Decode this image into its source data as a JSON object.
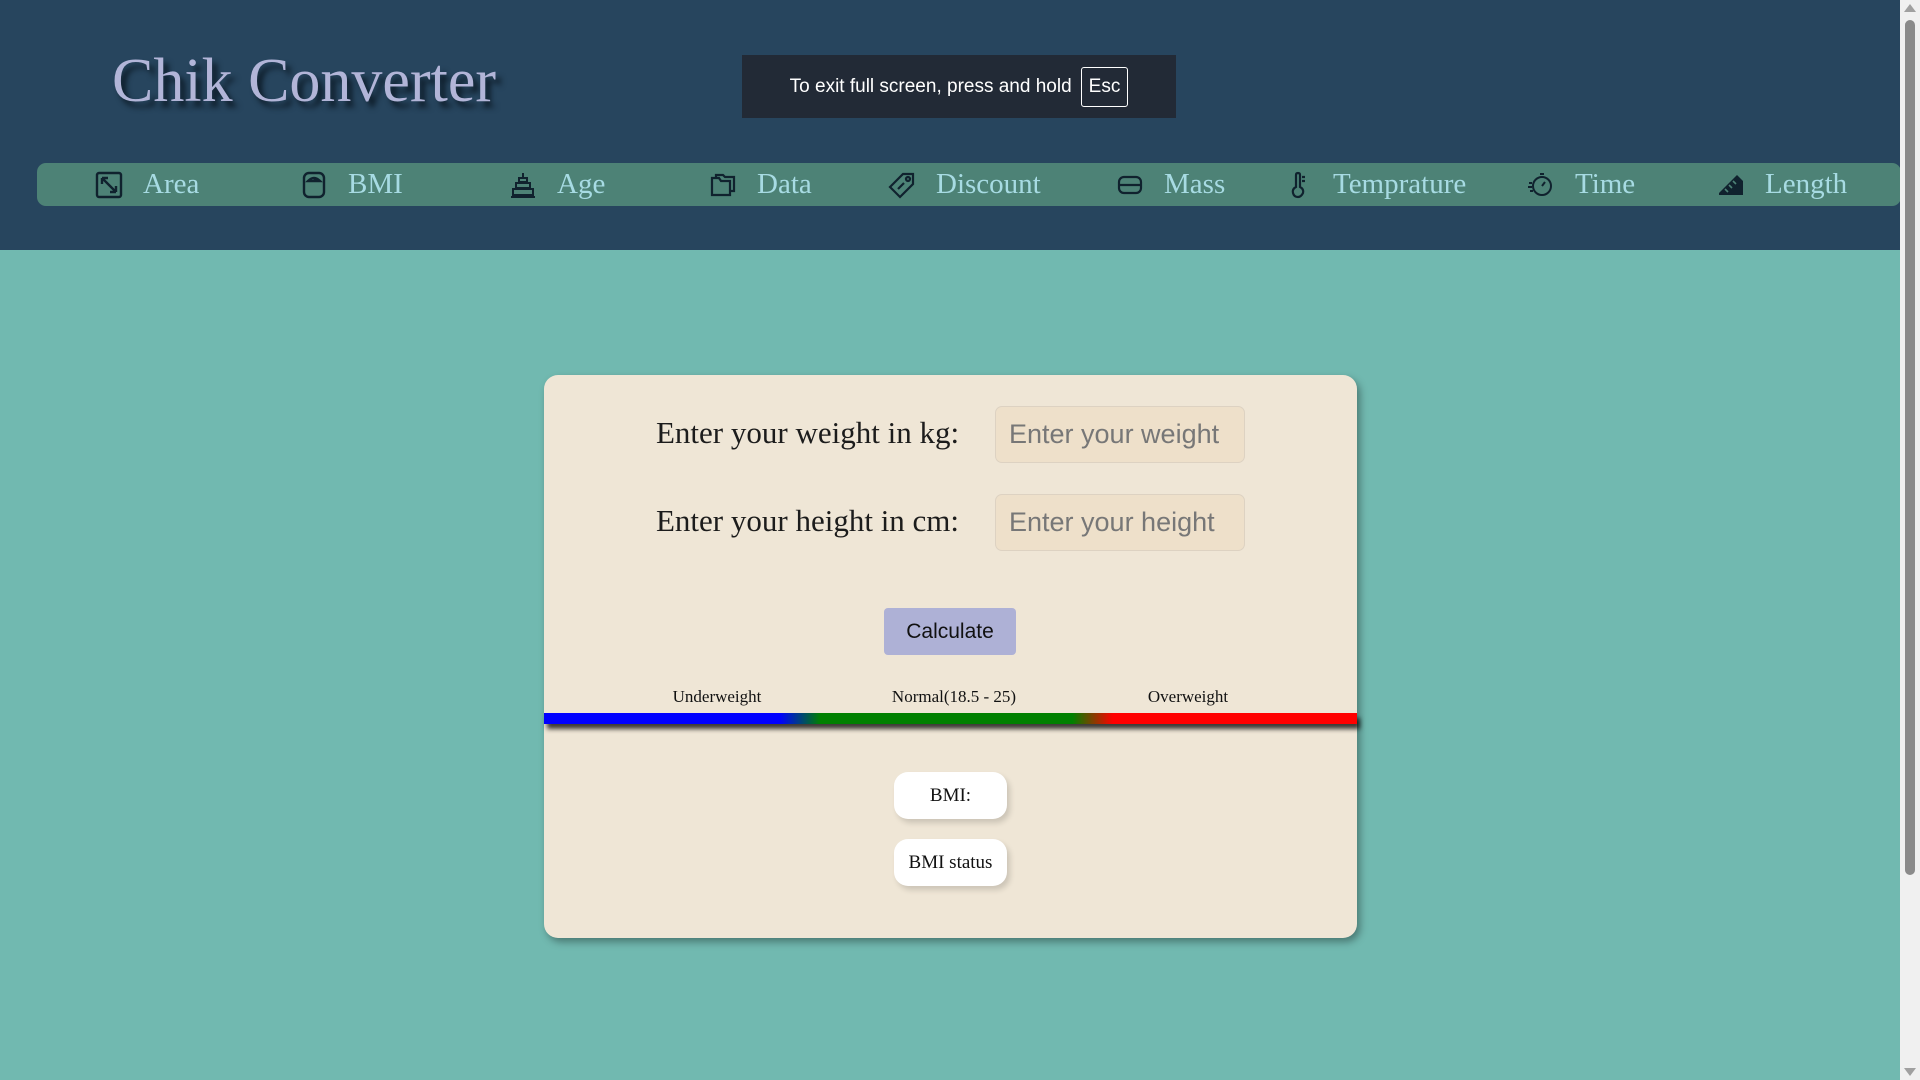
{
  "app": {
    "title": "Chik Converter"
  },
  "fullscreen_notice": {
    "text": "To exit full screen, press and hold",
    "key": "Esc"
  },
  "nav": {
    "items": [
      {
        "label": "Area",
        "icon": "area-icon"
      },
      {
        "label": "BMI",
        "icon": "scale-icon"
      },
      {
        "label": "Age",
        "icon": "age-icon"
      },
      {
        "label": "Data",
        "icon": "data-icon"
      },
      {
        "label": "Discount",
        "icon": "discount-tag-icon"
      },
      {
        "label": "Mass",
        "icon": "mass-icon"
      },
      {
        "label": "Temprature",
        "icon": "thermometer-icon"
      },
      {
        "label": "Time",
        "icon": "stopwatch-icon"
      },
      {
        "label": "Length",
        "icon": "ruler-icon"
      }
    ]
  },
  "bmi_form": {
    "weight_label": "Enter your weight in kg:",
    "weight_placeholder": "Enter your weight",
    "height_label": "Enter your height in cm:",
    "height_placeholder": "Enter your height",
    "calculate_label": "Calculate",
    "scale": {
      "underweight": "Underweight",
      "normal": "Normal(18.5 - 25)",
      "overweight": "Overweight"
    },
    "bmi_label": "BMI:",
    "status_label": "BMI status"
  },
  "colors": {
    "header_bg": "#27455e",
    "nav_bg": "#4d8276",
    "page_bg": "#71b9b0",
    "card_bg": "#efe6d6",
    "button_bg": "#aeb1d6",
    "scale_underweight": "#0000ff",
    "scale_normal": "#008000",
    "scale_overweight": "#ff0000"
  }
}
